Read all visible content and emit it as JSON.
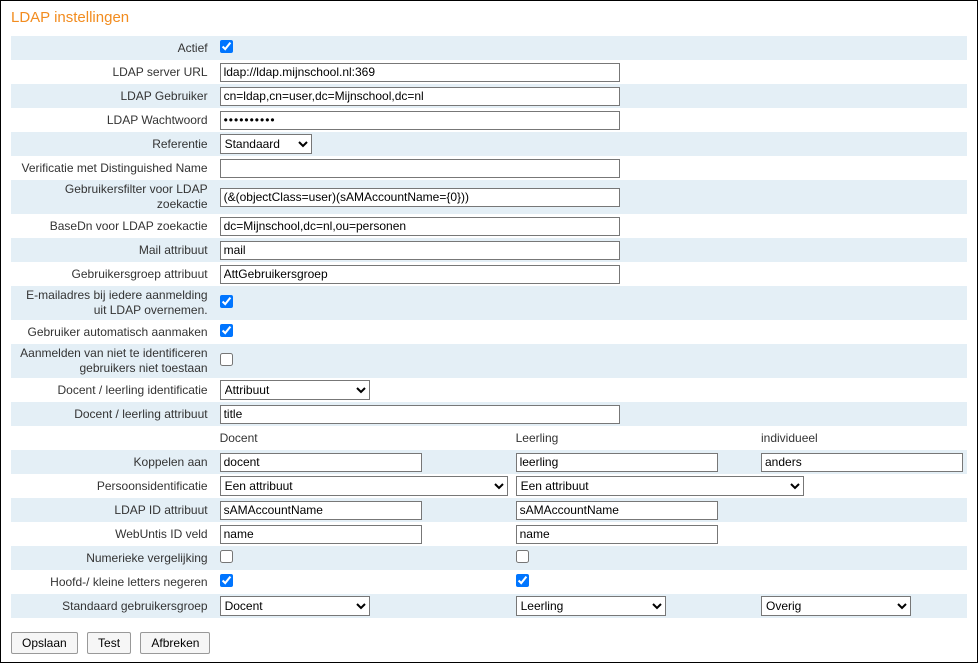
{
  "title": "LDAP instellingen",
  "labels": {
    "active": "Actief",
    "server_url": "LDAP server URL",
    "user": "LDAP Gebruiker",
    "password": "LDAP Wachtwoord",
    "reference": "Referentie",
    "verify_dn": "Verificatie met Distinguished Name",
    "user_filter": "Gebruikersfilter voor LDAP zoekactie",
    "base_dn": "BaseDn voor LDAP zoekactie",
    "mail_attr": "Mail attribuut",
    "group_attr": "Gebruikersgroep attribuut",
    "take_email": "E-mailadres bij iedere aanmelding uit LDAP overnemen.",
    "auto_create": "Gebruiker automatisch aanmaken",
    "deny_unident": "Aanmelden van niet te identificeren gebruikers niet toestaan",
    "ident_kind": "Docent / leerling identificatie",
    "ident_attr": "Docent / leerling attribuut",
    "link_to": "Koppelen aan",
    "person_ident": "Persoonsidentificatie",
    "id_attr": "LDAP ID attribuut",
    "webuntis_id": "WebUntis ID veld",
    "numeric_cmp": "Numerieke vergelijking",
    "ignore_case": "Hoofd-/ kleine letters negeren",
    "default_group": "Standaard gebruikersgroep"
  },
  "columns": {
    "teacher": "Docent",
    "student": "Leerling",
    "individual": "individueel"
  },
  "values": {
    "active": true,
    "server_url": "ldap://ldap.mijnschool.nl:369",
    "user": "cn=ldap,cn=user,dc=Mijnschool,dc=nl",
    "password": "••••••••••",
    "reference": "Standaard",
    "verify_dn": "",
    "user_filter": "(&(objectClass=user)(sAMAccountName={0}))",
    "base_dn": "dc=Mijnschool,dc=nl,ou=personen",
    "mail_attr": "mail",
    "group_attr": "AttGebruikersgroep",
    "take_email": true,
    "auto_create": true,
    "deny_unident": false,
    "ident_kind": "Attribuut",
    "ident_attr": "title",
    "link_teacher": "docent",
    "link_student": "leerling",
    "link_individual": "anders",
    "person_ident_teacher": "Een attribuut",
    "person_ident_student": "Een attribuut",
    "id_attr_teacher": "sAMAccountName",
    "id_attr_student": "sAMAccountName",
    "webuntis_id_teacher": "name",
    "webuntis_id_student": "name",
    "numeric_teacher": false,
    "numeric_student": false,
    "ignore_case_teacher": true,
    "ignore_case_student": true,
    "default_group_teacher": "Docent",
    "default_group_student": "Leerling",
    "default_group_individual": "Overig"
  },
  "buttons": {
    "save": "Opslaan",
    "test": "Test",
    "cancel": "Afbreken"
  }
}
